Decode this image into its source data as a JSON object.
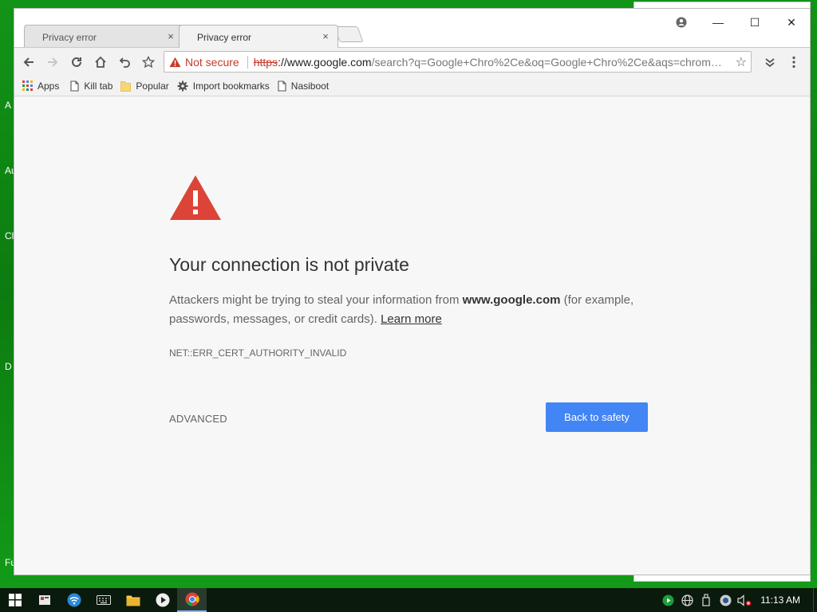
{
  "desktop": {
    "labels": [
      "A",
      "Au",
      "Cl",
      "D",
      "Fu"
    ]
  },
  "browser": {
    "tabs": [
      {
        "title": "Privacy error",
        "close": "×",
        "active": false
      },
      {
        "title": "Privacy error",
        "close": "×",
        "active": true
      }
    ],
    "window_controls": {
      "minimize": "—",
      "maximize": "☐",
      "close": "✕"
    },
    "omnibox": {
      "security_label": "Not secure",
      "scheme": "https",
      "host": "://www.google.com",
      "path": "/search?q=Google+Chro%2Ce&oq=Google+Chro%2Ce&aqs=chrom…"
    },
    "bookmarks": [
      {
        "label": "Apps",
        "icon": "apps-grid-icon"
      },
      {
        "label": "Kill tab",
        "icon": "page-icon"
      },
      {
        "label": "Popular",
        "icon": "folder-icon"
      },
      {
        "label": "Import bookmarks",
        "icon": "gear-icon"
      },
      {
        "label": "Nasiboot",
        "icon": "page-icon"
      }
    ]
  },
  "interstitial": {
    "title": "Your connection is not private",
    "desc_prefix": "Attackers might be trying to steal your information from ",
    "desc_host": "www.google.com",
    "desc_suffix": " (for example, passwords, messages, or credit cards). ",
    "learn_more": "Learn more",
    "error_code": "NET::ERR_CERT_AUTHORITY_INVALID",
    "advanced": "ADVANCED",
    "back_button": "Back to safety",
    "colors": {
      "warning": "#db4437",
      "button": "#4285f4"
    }
  },
  "taskbar": {
    "clock": "11:13 AM"
  }
}
